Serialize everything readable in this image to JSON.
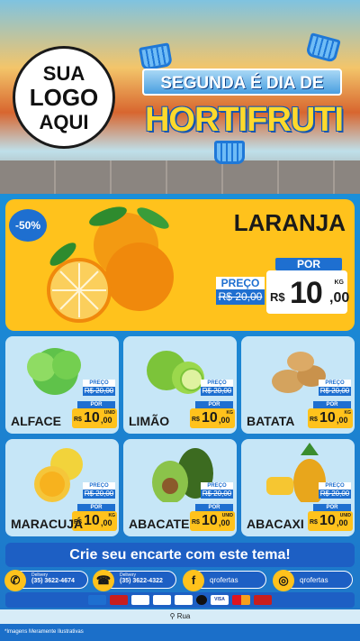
{
  "header": {
    "logo_line1": "SUA",
    "logo_line2": "LOGO",
    "logo_line3": "AQUI",
    "banner_top": "SEGUNDA É DIA DE",
    "banner_main": "HORTIFRUTI"
  },
  "featured": {
    "discount": "-50%",
    "name": "LARANJA",
    "preco_label": "PREÇO",
    "old_price": "R$ 20,00",
    "por_label": "POR",
    "currency": "R$",
    "price_int": "10",
    "price_dec": ",00",
    "unit": "KG"
  },
  "products": [
    {
      "name": "ALFACE",
      "preco_label": "PREÇO",
      "old": "R$ 20,00",
      "por": "POR",
      "cur": "R$",
      "int": "10",
      "dec": ",00",
      "unit": "UNID"
    },
    {
      "name": "LIMÃO",
      "preco_label": "PREÇO",
      "old": "R$ 20,00",
      "por": "POR",
      "cur": "R$",
      "int": "10",
      "dec": ",00",
      "unit": "KG"
    },
    {
      "name": "BATATA",
      "preco_label": "PREÇO",
      "old": "R$ 20,00",
      "por": "POR",
      "cur": "R$",
      "int": "10",
      "dec": ",00",
      "unit": "KG"
    },
    {
      "name": "MARACUJÁ",
      "preco_label": "PREÇO",
      "old": "R$ 20,00",
      "por": "POR",
      "cur": "R$",
      "int": "10",
      "dec": ",00",
      "unit": "KG"
    },
    {
      "name": "ABACATE",
      "preco_label": "PREÇO",
      "old": "R$ 20,00",
      "por": "POR",
      "cur": "R$",
      "int": "10",
      "dec": ",00",
      "unit": "UNID"
    },
    {
      "name": "ABACAXI",
      "preco_label": "PREÇO",
      "old": "R$ 20,00",
      "por": "POR",
      "cur": "R$",
      "int": "10",
      "dec": ",00",
      "unit": "UNID"
    }
  ],
  "cta": "Crie seu encarte com este tema!",
  "contacts": {
    "whatsapp_label": "Delivery",
    "whatsapp_number": "(35) 3622-4674",
    "phone_label": "Delivery",
    "phone_number": "(35) 3622-4322",
    "facebook": "qrofertas",
    "instagram": "qrofertas"
  },
  "payments": [
    "",
    "",
    "",
    "",
    "",
    "",
    "VISA",
    "",
    ""
  ],
  "address": "Rua",
  "footer": "*Imagens Meramente Ilustrativas",
  "colors": {
    "yellow": "#ffc21c",
    "blue": "#1e6fd0",
    "dark_blue": "#1d5fc4",
    "card_bg": "#c6e6f7"
  }
}
